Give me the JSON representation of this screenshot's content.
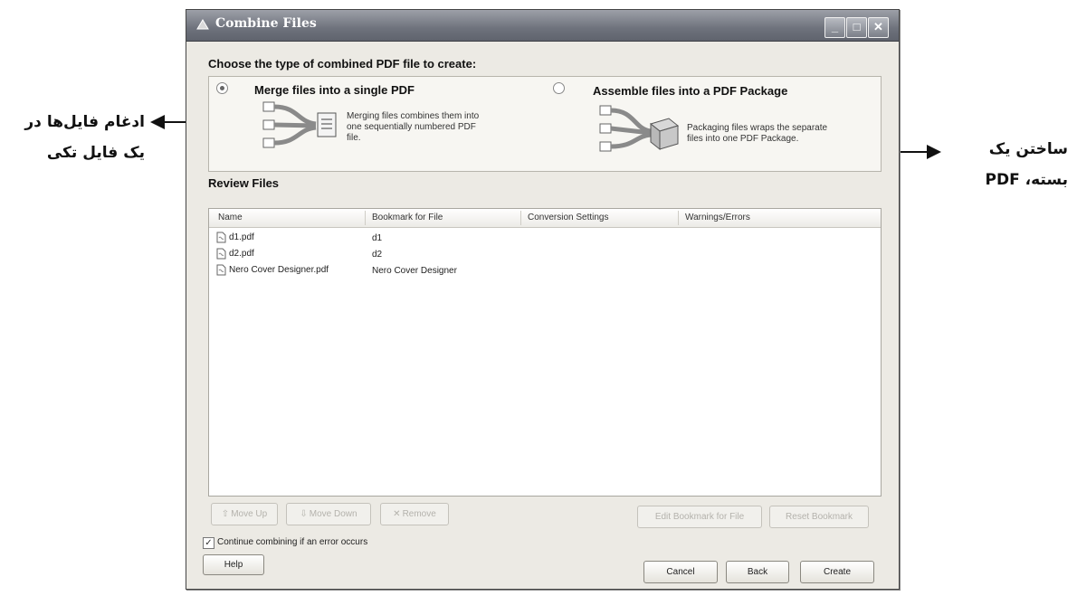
{
  "annotations": {
    "left": [
      "ادغام فایل‌ها در",
      "یک فایل تکی"
    ],
    "right": [
      "ساختن یک",
      "بسته، PDF"
    ]
  },
  "window": {
    "title": "Combine Files",
    "controls": {
      "minimize": "_",
      "maximize": "□",
      "close": "✕"
    }
  },
  "type_section": {
    "heading": "Choose the type of combined PDF file to create:",
    "merge": {
      "label": "Merge files into a single PDF",
      "desc": [
        "Merging files combines them into",
        "one sequentially numbered PDF",
        "file."
      ],
      "selected": true
    },
    "package": {
      "label": "Assemble files into a PDF Package",
      "desc": [
        "Packaging files wraps the separate",
        "files into one PDF Package."
      ],
      "selected": false
    }
  },
  "review": {
    "heading": "Review Files",
    "columns": [
      "Name",
      "Bookmark for File",
      "Conversion Settings",
      "Warnings/Errors"
    ],
    "rows": [
      {
        "name": "d1.pdf",
        "bookmark": "d1"
      },
      {
        "name": "d2.pdf",
        "bookmark": "d2"
      },
      {
        "name": "Nero Cover Designer.pdf",
        "bookmark": "Nero Cover Designer"
      }
    ]
  },
  "list_buttons": {
    "move_up": "Move Up",
    "move_down": "Move Down",
    "remove": "Remove",
    "edit_bookmark": "Edit Bookmark for File",
    "reset_bookmark": "Reset Bookmark"
  },
  "options": {
    "continue_label": "Continue combining if an error occurs",
    "continue_checked": true
  },
  "footer": {
    "help": "Help",
    "cancel": "Cancel",
    "back": "Back",
    "create": "Create"
  }
}
